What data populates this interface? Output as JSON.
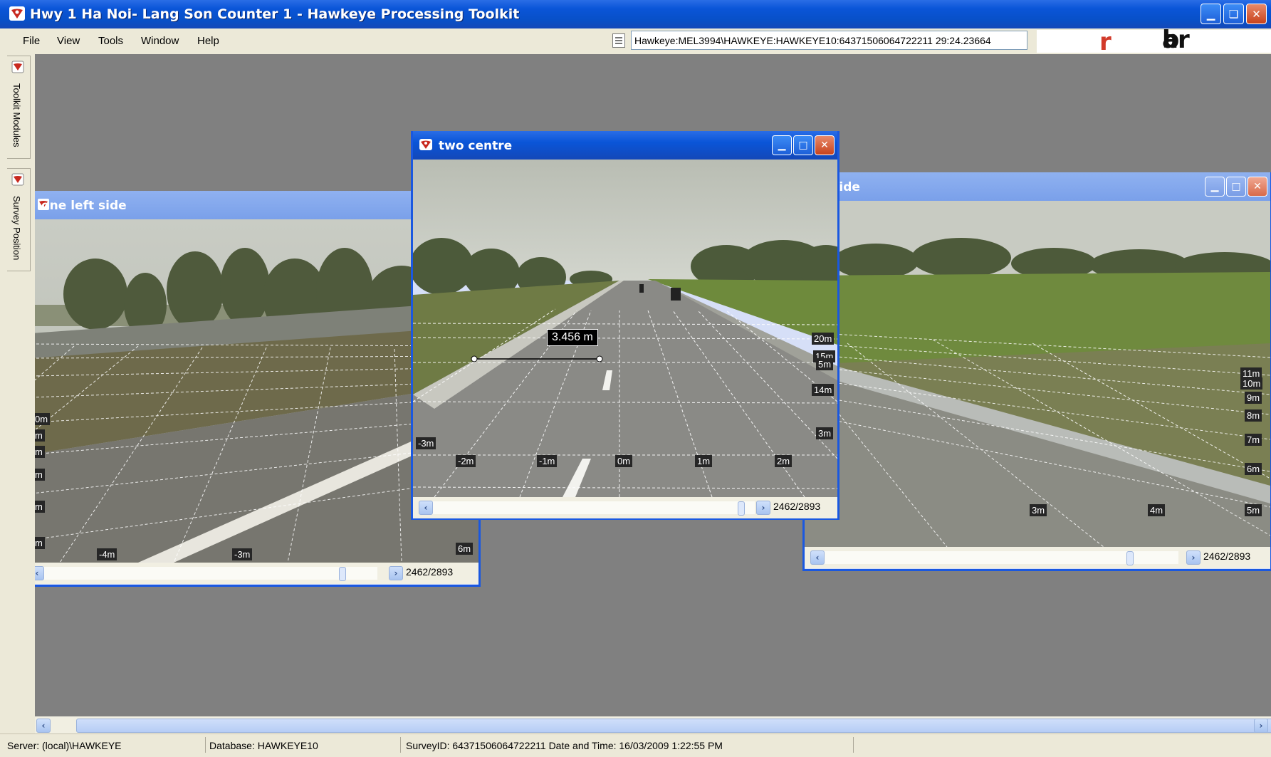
{
  "window": {
    "title": "Hwy 1 Ha Noi- Lang Son Counter 1 - Hawkeye Processing Toolkit",
    "accent": "#0a55d8"
  },
  "menu": {
    "file": "File",
    "view": "View",
    "tools": "Tools",
    "window": "Window",
    "help": "Help"
  },
  "path_field": {
    "value": "Hawkeye:MEL3994\\HAWKEYE:HAWKEYE10:64371506064722211 29:24.23664"
  },
  "brand": {
    "logo_a": "ar",
    "logo_o": "r",
    "logo_b": "b"
  },
  "dock": {
    "toolkit_modules": "Toolkit Modules",
    "survey_position": "Survey Position"
  },
  "child_left": {
    "title": "one left side",
    "counter": "2462/2893",
    "labels_left": [
      "0m",
      "m",
      "m",
      "m",
      "m",
      "m"
    ],
    "labels_bottom": [
      "-4m",
      "-3m",
      "6m"
    ]
  },
  "child_center": {
    "title": "two centre",
    "counter": "2462/2893",
    "measurement": "3.456 m",
    "labels_bottom": [
      "-2m",
      "-1m",
      "0m",
      "1m",
      "2m"
    ],
    "labels_right": [
      "20m",
      "15m",
      "5m",
      "14m",
      "3m"
    ],
    "label_left": "-3m"
  },
  "child_right": {
    "title": "ght side",
    "counter": "2462/2893",
    "labels_right": [
      "11m",
      "10m",
      "9m",
      "8m",
      "7m",
      "6m",
      "5m"
    ],
    "labels_bottom": [
      "3m",
      "4m"
    ]
  },
  "status": {
    "server": "Server: (local)\\HAWKEYE",
    "database": "Database: HAWKEYE10",
    "survey": "SurveyID: 64371506064722211 Date and Time: 16/03/2009 1:22:55 PM"
  }
}
